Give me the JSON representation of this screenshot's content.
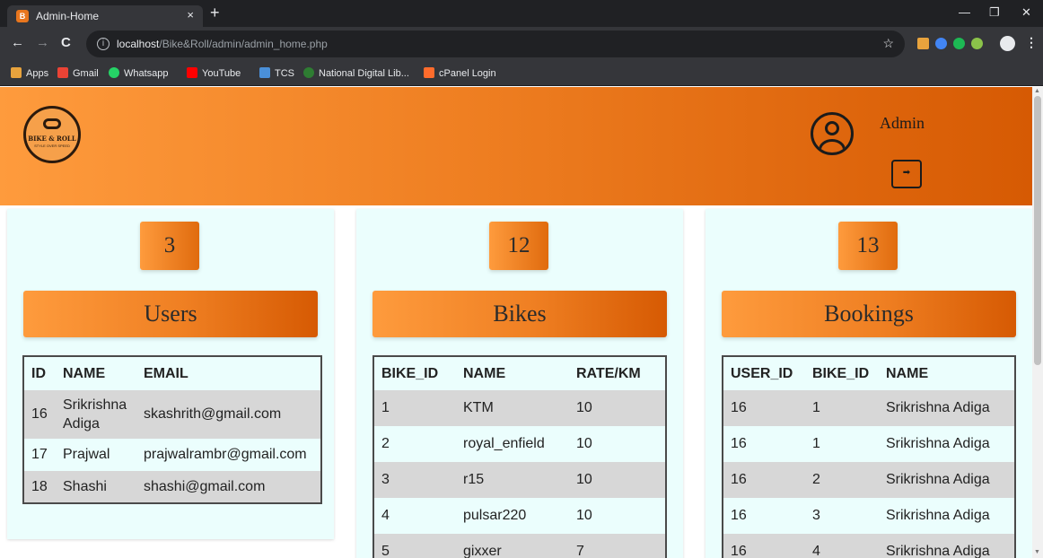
{
  "browser": {
    "tab_title": "Admin-Home",
    "tab_favicon": "B",
    "new_tab_label": "+",
    "url_host": "localhost",
    "url_path": "/Bike&Roll/admin/admin_home.php",
    "info_icon_glyph": "i",
    "back_glyph": "←",
    "forward_glyph": "→",
    "reload_glyph": "C",
    "star_glyph": "☆",
    "menu_glyph": "⋮",
    "close_glyph": "×",
    "minimize_glyph": "—",
    "restore_glyph": "❐",
    "window_close_glyph": "✕",
    "bookmarks": [
      {
        "label": "Apps",
        "icon": "apps-icon",
        "color": "#e8a33d"
      },
      {
        "label": "Gmail",
        "icon": "gmail-icon",
        "color": "#ea4335"
      },
      {
        "label": "Whatsapp",
        "icon": "whatsapp-icon",
        "color": "#25d366"
      },
      {
        "label": "YouTube",
        "icon": "youtube-icon",
        "color": "#ff0000"
      },
      {
        "label": "TCS",
        "icon": "tcs-icon",
        "color": "#4a90d9"
      },
      {
        "label": "National Digital Lib...",
        "icon": "ndl-icon",
        "color": "#2e7d32"
      },
      {
        "label": "cPanel Login",
        "icon": "cpanel-icon",
        "color": "#ff6c2c"
      }
    ]
  },
  "header": {
    "logo_text": "BIKE & ROLL",
    "logo_tagline": "STYLE OVER SPEED",
    "admin_name": "Admin",
    "logout_glyph": "➡"
  },
  "users": {
    "count": "3",
    "title": "Users",
    "columns": [
      "ID",
      "NAME",
      "EMAIL"
    ],
    "rows": [
      [
        "16",
        "Srikrishna Adiga",
        "skashrith@gmail.com"
      ],
      [
        "17",
        "Prajwal",
        "prajwalrambr@gmail.com"
      ],
      [
        "18",
        "Shashi",
        "shashi@gmail.com"
      ]
    ]
  },
  "bikes": {
    "count": "12",
    "title": "Bikes",
    "columns": [
      "BIKE_ID",
      "NAME",
      "RATE/KM"
    ],
    "rows": [
      [
        "1",
        "KTM",
        "10"
      ],
      [
        "2",
        "royal_enfield",
        "10"
      ],
      [
        "3",
        "r15",
        "10"
      ],
      [
        "4",
        "pulsar220",
        "10"
      ],
      [
        "5",
        "gixxer",
        "7"
      ]
    ]
  },
  "bookings": {
    "count": "13",
    "title": "Bookings",
    "columns": [
      "USER_ID",
      "BIKE_ID",
      "NAME"
    ],
    "rows": [
      [
        "16",
        "1",
        "Srikrishna Adiga"
      ],
      [
        "16",
        "1",
        "Srikrishna Adiga"
      ],
      [
        "16",
        "2",
        "Srikrishna Adiga"
      ],
      [
        "16",
        "3",
        "Srikrishna Adiga"
      ],
      [
        "16",
        "4",
        "Srikrishna Adiga"
      ]
    ]
  },
  "colors": {
    "accent_orange": "#ef7f22",
    "card_background": "#ebfefd",
    "row_stripe": "#d7d7d7"
  }
}
